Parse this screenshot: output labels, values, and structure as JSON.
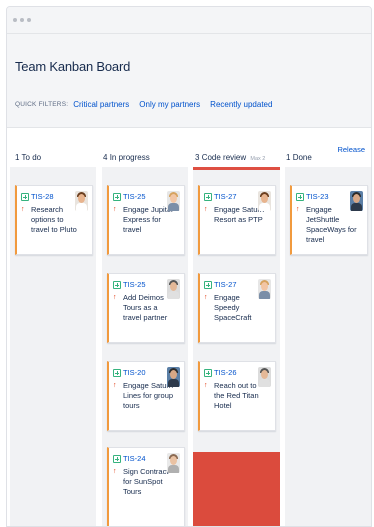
{
  "window": {
    "dots": 3
  },
  "board": {
    "title": "Team Kanban Board"
  },
  "filters": {
    "label": "QUICK FILTERS:",
    "items": [
      "Critical partners",
      "Only my partners",
      "Recently updated"
    ]
  },
  "release_label": "Release",
  "columns": [
    {
      "count": "1",
      "name": "To do",
      "max": ""
    },
    {
      "count": "4",
      "name": "In progress",
      "max": ""
    },
    {
      "count": "3",
      "name": "Code review",
      "max": "Max 2"
    },
    {
      "count": "1",
      "name": "Done",
      "max": ""
    }
  ],
  "cards": {
    "todo": [
      {
        "key": "TIS-28",
        "summary": "Research options to travel to Pluto"
      }
    ],
    "progress": [
      {
        "key": "TIS-25",
        "summary": "Engage Jupiter Express for travel"
      },
      {
        "key": "TIS-25",
        "summary": "Add Deimos Tours as a travel partner"
      },
      {
        "key": "TIS-20",
        "summary": "Engage Saturn Lines for group tours"
      },
      {
        "key": "TIS-24",
        "summary": "Sign Contract for SunSpot Tours"
      }
    ],
    "review": [
      {
        "key": "TIS-27",
        "summary": "Engage Saturn Resort as PTP"
      },
      {
        "key": "TIS-27",
        "summary": "Engage Speedy SpaceCraft"
      },
      {
        "key": "TIS-26",
        "summary": "Reach out to the Red Titan Hotel"
      }
    ],
    "done": [
      {
        "key": "TIS-23",
        "summary": "Engage JetShuttle SpaceWays for travel"
      }
    ]
  },
  "colors": {
    "accent": "#0052cc",
    "review_limit": "#db4b3d",
    "card_border": "#f19a3e",
    "story": "#36b37e",
    "priority": "#de350b"
  },
  "icons": {
    "story": "story-icon",
    "priority": "arrow-up-icon",
    "avatar": "user-avatar"
  }
}
